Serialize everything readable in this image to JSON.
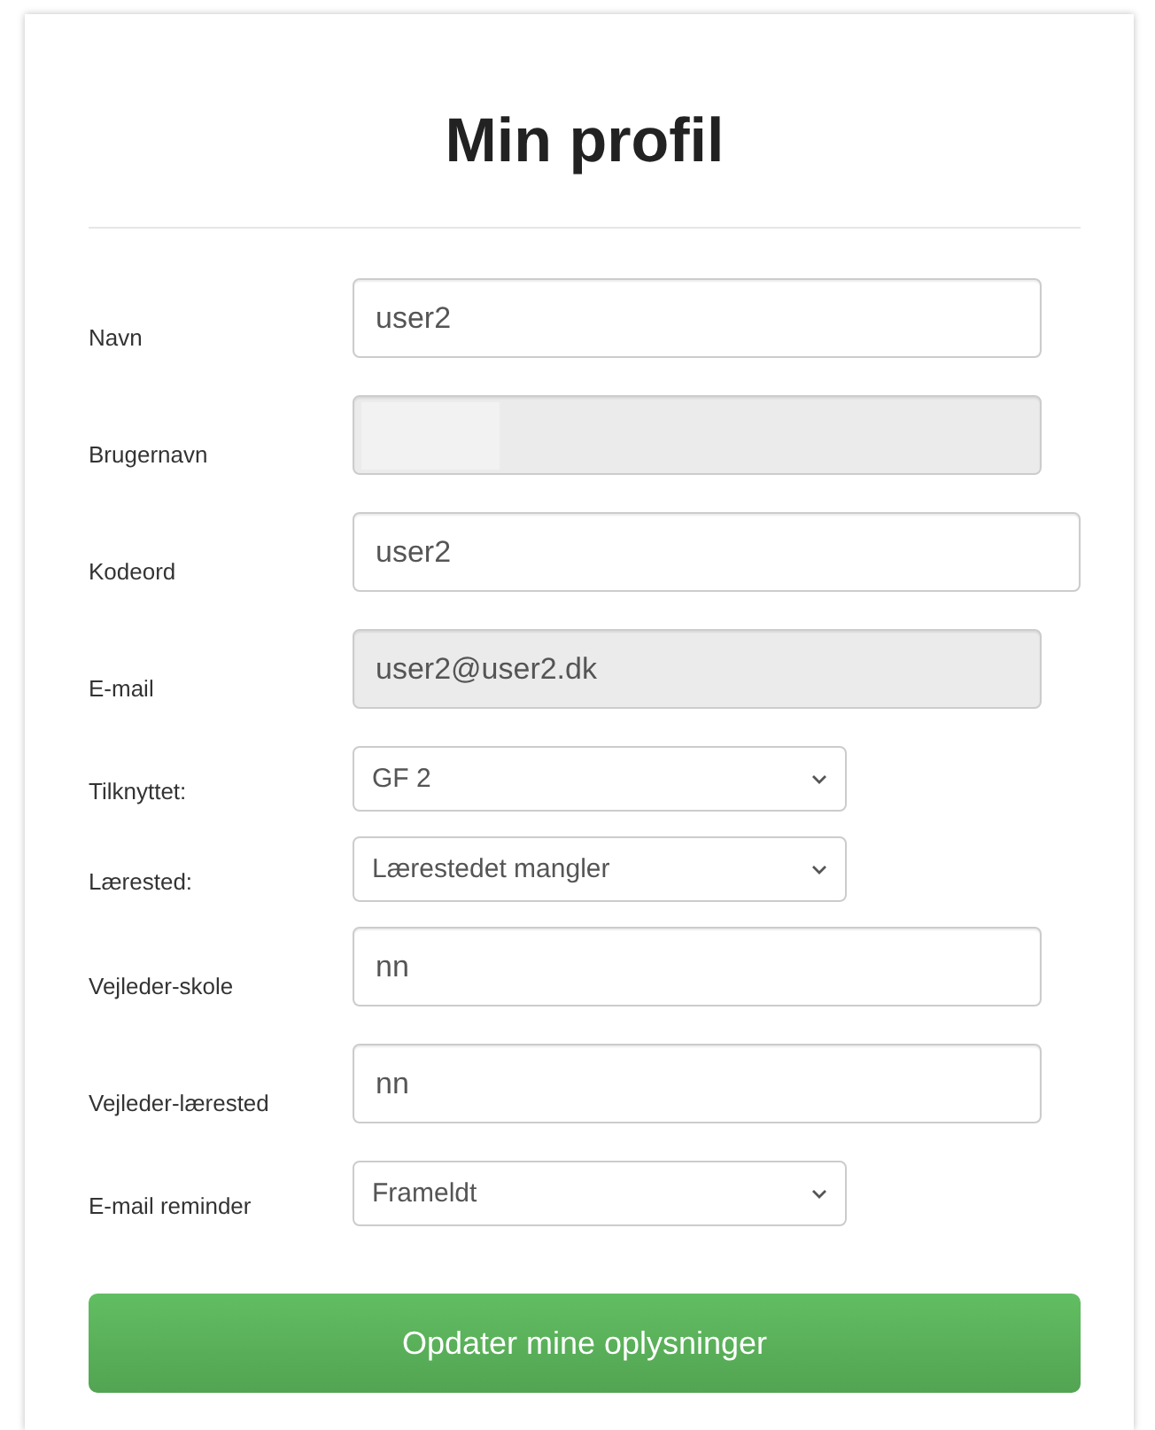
{
  "title": "Min profil",
  "fields": [
    {
      "label": "Navn",
      "kind": "text",
      "value": "user2",
      "disabled": false
    },
    {
      "label": "Brugernavn",
      "kind": "text",
      "disabled": true
    },
    {
      "label": "Kodeord",
      "kind": "text",
      "value": "user2",
      "disabled": false
    },
    {
      "label": "E-mail",
      "kind": "text",
      "value": "user2@user2.dk",
      "disabled": true
    },
    {
      "label": "Tilknyttet:",
      "kind": "select",
      "value": "GF 2"
    },
    {
      "label": "Lærested:",
      "kind": "select",
      "value": "Lærestedet mangler"
    },
    {
      "label": "Vejleder-skole",
      "kind": "text",
      "value": "nn",
      "disabled": false
    },
    {
      "label": "Vejleder-lærested",
      "kind": "text",
      "value": "nn",
      "disabled": false
    },
    {
      "label": "E-mail reminder",
      "kind": "select",
      "value": "Frameldt"
    }
  ],
  "submit": "Opdater mine oplysninger"
}
